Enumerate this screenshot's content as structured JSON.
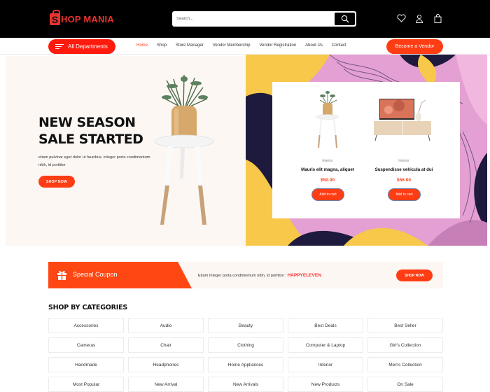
{
  "header": {
    "logo_letter": "S",
    "logo_text": "HOP MANIA",
    "search_placeholder": "Search...",
    "icons": [
      "heart-icon",
      "user-icon",
      "shopping-bag-icon"
    ]
  },
  "nav": {
    "departments_label": "All Departments",
    "links": [
      "Home",
      "Shop",
      "Store Manager",
      "Vendor Membership",
      "Vendor Registration",
      "About Us",
      "Contact"
    ],
    "active": "Home",
    "vendor_button": "Become a Vendor"
  },
  "hero": {
    "title": "NEW SEASON SALE STARTED",
    "description": "etiam pulvinar eget dolor ut faucibus. integer porta condimentum nibh, id porttitor",
    "button": "SHOP NOW"
  },
  "featured_products": [
    {
      "category": "Interior",
      "name": "Mauris elit magna, aliquet",
      "price": "$50.00",
      "button": "Add to cart"
    },
    {
      "category": "Interior",
      "name": "Suspendisse vehicula at dui",
      "price": "$56.00",
      "button": "Add to cart"
    }
  ],
  "coupon": {
    "label": "Special Coupon",
    "text": "Etiam Integer porta condimentum nibh, id porttitor : ",
    "code": "HAPPYELEVEN",
    "button": "SHOP NOW"
  },
  "categories": {
    "title": "SHOP BY CATEGORIES",
    "items": [
      "Accessories",
      "Audio",
      "Beauty",
      "Best Deals",
      "Best Seller",
      "Cameras",
      "Chair",
      "Clothing",
      "Computer & Laptop",
      "Girl's Collection",
      "Handmade",
      "Headphones",
      "Home Appliances",
      "Interior",
      "Men's Collection",
      "Most Popular",
      "New Arrival",
      "New Arrivals",
      "New Products",
      "On Sale"
    ]
  },
  "colors": {
    "brand": "#e8322e",
    "accent": "#ff3d14",
    "header_bg": "#000000",
    "hero_bg": "#fdf7f3"
  }
}
